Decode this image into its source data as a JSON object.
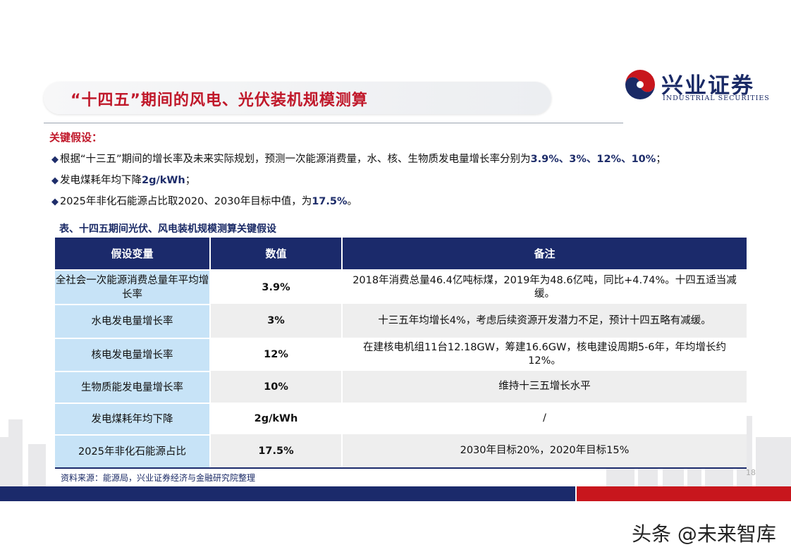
{
  "header": {
    "title": "“十四五”期间的风电、光伏装机规模测算",
    "logo_cn": "兴业证券",
    "logo_en": "INDUSTRIAL SECURITIES"
  },
  "assumptions": {
    "heading": "关键假设：",
    "points": [
      {
        "text": "根据“十三五”期间的增长率及未来实际规划，预测一次能源消费量，水、核、生物质发电量增长率分别为",
        "bold": "3.9%、3%、12%、10%",
        "end": "；"
      },
      {
        "text": "发电煤耗年均下降",
        "bold": "2g/kWh",
        "end": "；"
      },
      {
        "text": "2025年非化石能源占比取2020、2030年目标中值，为",
        "bold": "17.5%",
        "end": "。"
      }
    ]
  },
  "table": {
    "caption": "表、十四五期间光伏、风电装机规模测算关键假设",
    "headers": [
      "假设变量",
      "数值",
      "备注"
    ],
    "rows": [
      {
        "variable": "全社会一次能源消费总量年平均增长率",
        "value": "3.9%",
        "note": "2018年消费总量46.4亿吨标煤，2019年为48.6亿吨，同比+4.74%。十四五适当减缓。"
      },
      {
        "variable": "水电发电量增长率",
        "value": "3%",
        "note": "十三五年均增长4%，考虑后续资源开发潜力不足，预计十四五略有减缓。"
      },
      {
        "variable": "核电发电量增长率",
        "value": "12%",
        "note": "在建核电机组11台12.18GW，筹建16.6GW，核电建设周期5-6年，年均增长约12%。"
      },
      {
        "variable": "生物质能发电量增长率",
        "value": "10%",
        "note": "维持十三五增长水平"
      },
      {
        "variable": "发电煤耗年均下降",
        "value": "2g/kWh",
        "note": "/"
      },
      {
        "variable": "2025年非化石能源占比",
        "value": "17.5%",
        "note": "2030年目标20%，2020年目标15%"
      }
    ],
    "source": "资料来源：能源局，兴业证券经济与金融研究院整理"
  },
  "page_number": "18",
  "watermark": "头条 @未来智库",
  "colors": {
    "navy": "#1b2a6b",
    "red": "#c0182a",
    "light_blue": "#c7e3f7",
    "light_gray": "#eeeeee"
  }
}
